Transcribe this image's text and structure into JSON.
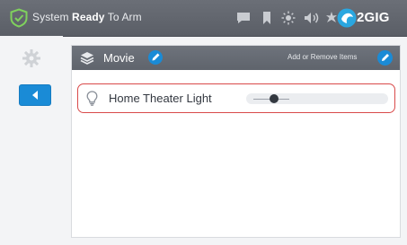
{
  "header": {
    "status_prefix": "System ",
    "status_bold": "Ready",
    "status_suffix": " To Arm",
    "brand": "2GIG",
    "icons": [
      "shield-check-icon",
      "message-icon",
      "bookmark-icon",
      "brightness-icon",
      "volume-icon",
      "settings-wheel-icon",
      "brand-logo-icon"
    ]
  },
  "panel": {
    "title": "Movie",
    "add_remove_label": "Add or Remove Items"
  },
  "devices": [
    {
      "name": "Home Theater Light",
      "icon": "light-bulb-icon",
      "dimmer_level_fraction": 0.15
    }
  ],
  "colors": {
    "accent_blue": "#1a8bd6",
    "header_gray": "#62666e",
    "highlight_red": "#d94a4a"
  }
}
